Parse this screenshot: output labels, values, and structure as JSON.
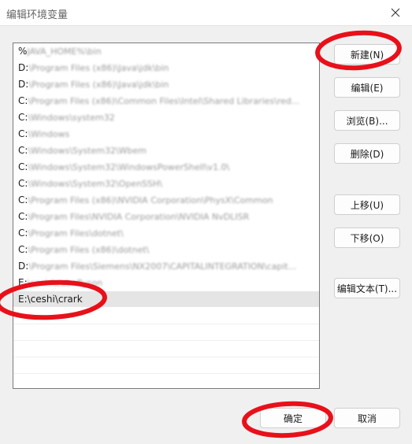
{
  "window": {
    "title": "编辑环境变量"
  },
  "paths": [
    {
      "prefix": "%",
      "hidden": "JAVA_HOME%\\bin"
    },
    {
      "prefix": "D:",
      "hidden": "\\Program Files (x86)\\Java\\jdk\\bin"
    },
    {
      "prefix": "D:",
      "hidden": "\\Program Files (x86)\\Java\\jdk\\bin"
    },
    {
      "prefix": "C:",
      "hidden": "\\Program Files (x86)\\Common Files\\Intel\\Shared Libraries\\red..."
    },
    {
      "prefix": "C:",
      "hidden": "\\Windows\\system32"
    },
    {
      "prefix": "C:",
      "hidden": "\\Windows"
    },
    {
      "prefix": "C:",
      "hidden": "\\Windows\\System32\\Wbem"
    },
    {
      "prefix": "C:",
      "hidden": "\\Windows\\System32\\WindowsPowerShell\\v1.0\\"
    },
    {
      "prefix": "C:",
      "hidden": "\\Windows\\System32\\OpenSSH\\"
    },
    {
      "prefix": "C:",
      "hidden": "\\Program Files (x86)\\NVIDIA Corporation\\PhysX\\Common"
    },
    {
      "prefix": "C:",
      "hidden": "\\Program Files\\NVIDIA Corporation\\NVIDIA NvDLISR"
    },
    {
      "prefix": "C:",
      "hidden": "\\Program Files\\dotnet\\"
    },
    {
      "prefix": "C:",
      "hidden": "\\Program Files (x86)\\dotnet\\"
    },
    {
      "prefix": "D:",
      "hidden": "\\Program Files\\Siemens\\NX2007\\CAPITALINTEGRATION\\capit..."
    },
    {
      "prefix": "E:",
      "hidden": "\\ceshi\\cubeflyson"
    },
    {
      "prefix": "E:\\ceshi\\crark",
      "hidden": ""
    }
  ],
  "buttons": {
    "new": "新建(N)",
    "edit": "编辑(E)",
    "browse": "浏览(B)...",
    "delete": "删除(D)",
    "move_up": "上移(U)",
    "move_down": "下移(O)",
    "edit_text": "编辑文本(T)...",
    "ok": "确定",
    "cancel": "取消"
  },
  "colors": {
    "annotation": "#e8101a",
    "selection": "#e5e5e5"
  }
}
